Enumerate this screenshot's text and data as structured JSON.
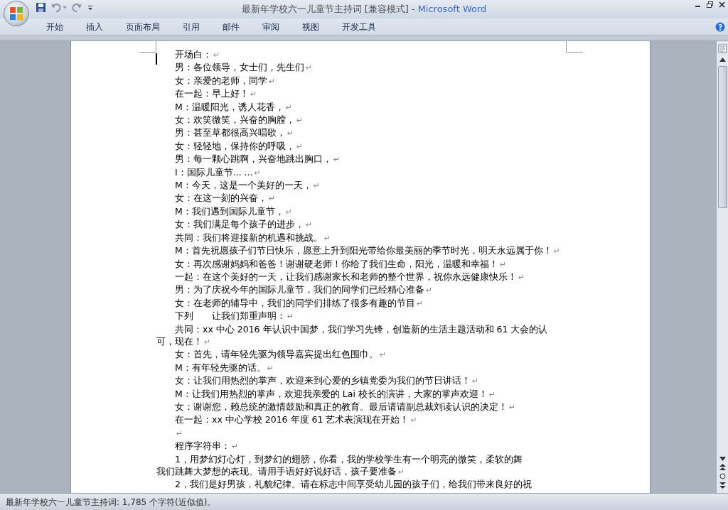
{
  "window": {
    "title": "最新年学校六一儿童节主持词 [兼容模式]",
    "separator": "-",
    "app": "Microsoft Word"
  },
  "ribbon_tabs": [
    {
      "label": "开始",
      "selected": false
    },
    {
      "label": "插入",
      "selected": false
    },
    {
      "label": "页面布局",
      "selected": false
    },
    {
      "label": "引用",
      "selected": false
    },
    {
      "label": "邮件",
      "selected": false
    },
    {
      "label": "审阅",
      "selected": false
    },
    {
      "label": "视图",
      "selected": false
    },
    {
      "label": "开发工具",
      "selected": false
    }
  ],
  "document": {
    "paragraphs": [
      {
        "lines": [
          "开场白："
        ],
        "mark": "↵"
      },
      {
        "lines": [
          "男：各位领导，女士们，先生们"
        ],
        "mark": "↵"
      },
      {
        "lines": [
          "女：亲爱的老师，同学"
        ],
        "mark": "↵"
      },
      {
        "lines": [
          "在一起：早上好！"
        ],
        "mark": "↵"
      },
      {
        "lines": [
          "M：温暖阳光，诱人花香，"
        ],
        "mark": "↵"
      },
      {
        "lines": [
          "女：欢笑微笑，兴奋的胸膛，"
        ],
        "mark": "↵"
      },
      {
        "lines": [
          "男：甚至草都很高兴唱歌，"
        ],
        "mark": "↵"
      },
      {
        "lines": [
          "女：轻轻地，保持你的呼吸，"
        ],
        "mark": "↵"
      },
      {
        "lines": [
          "男：每一颗心跳啊，兴奋地跳出胸口，"
        ],
        "mark": "↵"
      },
      {
        "lines": [
          "I：国际儿童节... ..."
        ],
        "mark": "↵"
      },
      {
        "lines": [
          "M：今天，这是一个美好的一天，"
        ],
        "mark": "↵"
      },
      {
        "lines": [
          "女：在这一刻的兴奋，"
        ],
        "mark": "↵"
      },
      {
        "lines": [
          "M：我们遇到国际儿童节，"
        ],
        "mark": "↵"
      },
      {
        "lines": [
          "女：我们满足每个孩子的进步，"
        ],
        "mark": "↵"
      },
      {
        "lines": [
          "共同：我们将迎接新的机遇和挑战。"
        ],
        "mark": "↵"
      },
      {
        "lines": [
          "M：首先祝愿孩子们节日快乐，愿意上升到阳光带给你最美丽的季节时光，明天永远属于你！"
        ],
        "mark": "↵"
      },
      {
        "lines": [
          "女：再次感谢妈妈和爸爸！谢谢硬老师！你给了我们生命，阳光，温暖和幸福！"
        ],
        "mark": "↵"
      },
      {
        "lines": [
          "一起：在这个美好的一天，让我们感谢家长和老师的整个世界，祝你永远健康快乐！"
        ],
        "mark": "↵"
      },
      {
        "lines": [
          "男：为了庆祝今年的国际儿童节，我们的同学们已经精心准备"
        ],
        "mark": "↵"
      },
      {
        "lines": [
          "女：在老师的辅导中，我们的同学们排练了很多有趣的节目"
        ],
        "mark": "↵"
      },
      {
        "lines": [
          "下列　　让我们郑重声明："
        ],
        "mark": "↵"
      },
      {
        "lines": [
          "共同：xx 中心 2016 年认识中国梦，我们学习先锋，创造新的生活主题活动和 61 大会的认",
          "可，现在！"
        ],
        "mark": "↵"
      },
      {
        "lines": [
          "女：首先，请年轻先驱为领导嘉宾提出红色围巾。"
        ],
        "mark": "↵"
      },
      {
        "lines": [
          "M：有年轻先驱的话。"
        ],
        "mark": "↵"
      },
      {
        "lines": [
          "女：让我们用热烈的掌声，欢迎来到心爱的乡镇党委为我们的节日讲话！"
        ],
        "mark": "↵"
      },
      {
        "lines": [
          "M：让我们用热烈的掌声，欢迎我亲爱的 Lai 校长的演讲，大家的掌声欢迎！"
        ],
        "mark": "↵"
      },
      {
        "lines": [
          "女：谢谢您，赖总统的激情鼓励和真正的教育。最后请请副总裁刘读认识的决定！"
        ],
        "mark": "↵"
      },
      {
        "lines": [
          "在一起：xx 中心学校 2016 年度 61 艺术表演现在开始！"
        ],
        "mark": "↵"
      },
      {
        "mark": "↵"
      },
      {
        "lines": [
          "程序字符串："
        ],
        "mark": "↵"
      },
      {
        "lines": [
          "1，用梦幻灯心灯，到梦幻的翅膀，你看，我的学校学生有一个明亮的微笑，柔软的舞",
          "我们跳舞大梦想的表现。请用手语好好说好话，孩子要准备"
        ],
        "mark": "↵"
      },
      {
        "lines": [
          "2，我们是好男孩，礼貌纪律。请在标志中间享受幼儿园的孩子们，给我们带来良好的祝"
        ]
      }
    ]
  },
  "status_bar": {
    "text": "最新年学校六一儿童节主持词: 1,785 个字符(近似值)。"
  }
}
